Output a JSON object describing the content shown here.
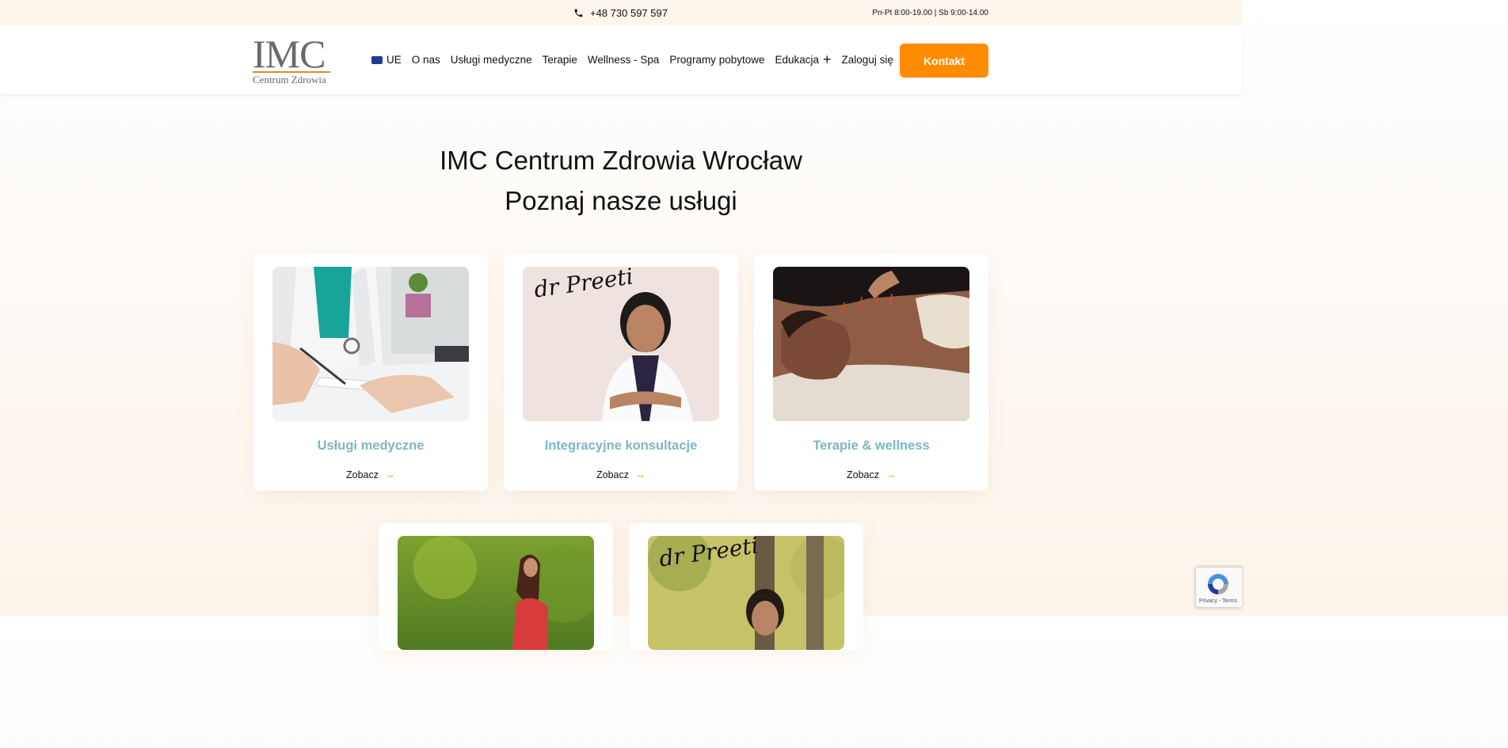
{
  "topbar": {
    "phone": "+48 730 597 597",
    "hours": "Pn-Pt 8:00-19.00 | Sb 9:00-14.00"
  },
  "logo": {
    "mark": "IMC",
    "sub": "Centrum Zdrowia"
  },
  "nav": {
    "items": [
      {
        "label": "UE"
      },
      {
        "label": "O nas"
      },
      {
        "label": "Usługi medyczne"
      },
      {
        "label": "Terapie"
      },
      {
        "label": "Wellness - Spa"
      },
      {
        "label": "Programy pobytowe"
      },
      {
        "label": "Edukacja"
      },
      {
        "label": "Zaloguj się"
      }
    ],
    "cta": "Kontakt"
  },
  "hero": {
    "title": "IMC Centrum Zdrowia Wrocław",
    "subtitle": "Poznaj nasze usługi"
  },
  "cards": [
    {
      "title": "Usługi medyczne",
      "more": "Zobacz"
    },
    {
      "title": "Integracyjne konsultacje",
      "more": "Zobacz",
      "signature": "dr Preeti"
    },
    {
      "title": "Terapie & wellness",
      "more": "Zobacz"
    },
    {
      "title": "",
      "more": ""
    },
    {
      "title": "",
      "more": "",
      "signature": "dr Preeti"
    }
  ],
  "recaptcha": {
    "text": "Privacy - Terms"
  },
  "colors": {
    "accent": "#ff8c00",
    "card_title": "#7cb6c9",
    "topbar_bg": "#fdf6ec"
  }
}
